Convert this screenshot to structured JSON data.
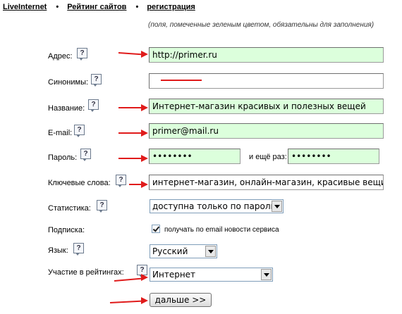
{
  "nav": {
    "links": [
      "LiveInternet",
      "Рейтинг сайтов",
      "регистрация"
    ],
    "separator": "•"
  },
  "note": "(поля, помеченные зеленым цветом, обязательны для заполнения)",
  "help_glyph": "?",
  "form": {
    "address": {
      "label": "Адрес:",
      "value": "http://primer.ru"
    },
    "synonyms": {
      "label": "Синонимы:",
      "value": ""
    },
    "name": {
      "label": "Название:",
      "value": "Интернет-магазин красивых и полезных вещей"
    },
    "email": {
      "label": "E-mail:",
      "value": "primer@mail.ru"
    },
    "password": {
      "label": "Пароль:",
      "value": "••••••••",
      "repeat_label": "и ещё раз:",
      "repeat_value": "••••••••"
    },
    "keywords": {
      "label": "Ключевые слова:",
      "value": "интернет-магазин, онлайн-магазин, красивые вещи, по"
    },
    "statistics": {
      "label": "Статистика:",
      "selected": "доступна только по паролю"
    },
    "subscription": {
      "label": "Подписка:",
      "checkbox_label": "получать по email новости сервиса",
      "checked": true
    },
    "language": {
      "label": "Язык:",
      "selected": "Русский"
    },
    "ratings": {
      "label": "Участие в рейтингах:",
      "selected": "Интернет"
    },
    "submit_label": "дальше >>"
  },
  "colors": {
    "required_field": "#dcffdc",
    "annotation_arrow": "#e01b1b"
  }
}
